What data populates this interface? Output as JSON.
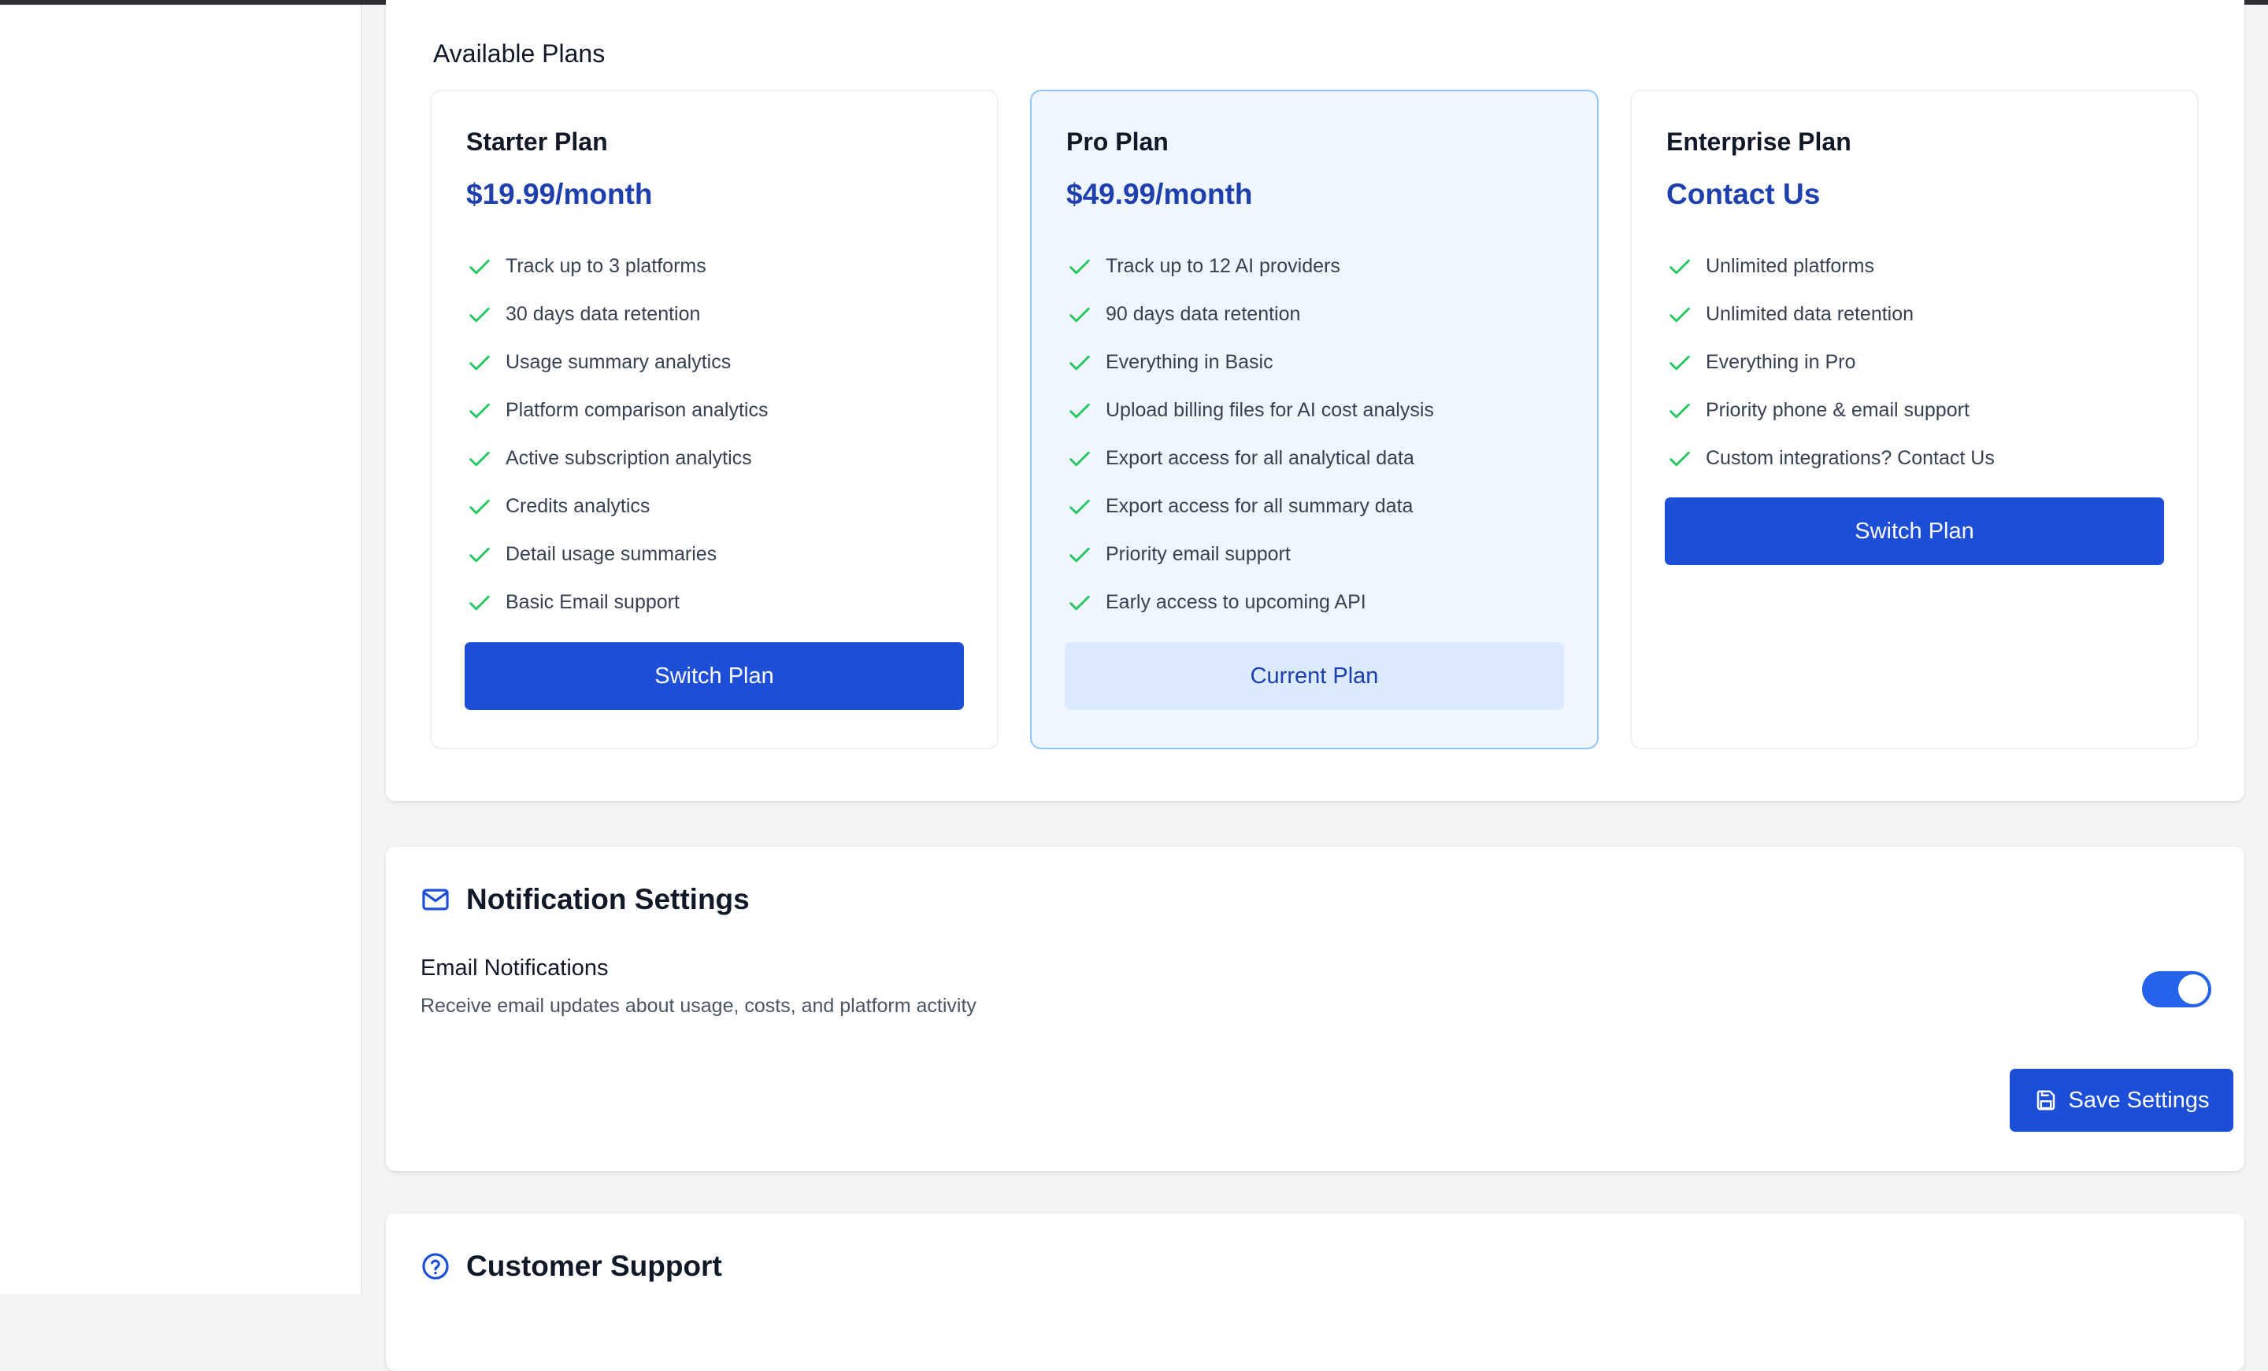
{
  "plans_section": {
    "title": "Available Plans",
    "plans": [
      {
        "name": "Starter Plan",
        "price": "$19.99/month",
        "features": [
          "Track up to 3 platforms",
          "30 days data retention",
          "Usage summary analytics",
          "Platform comparison analytics",
          "Active subscription analytics",
          "Credits analytics",
          "Detail usage summaries",
          "Basic Email support"
        ],
        "button_label": "Switch Plan"
      },
      {
        "name": "Pro Plan",
        "price": "$49.99/month",
        "features": [
          "Track up to 12 AI providers",
          "90 days data retention",
          "Everything in Basic",
          "Upload billing files for AI cost analysis",
          "Export access for all analytical data",
          "Export access for all summary data",
          "Priority email support",
          "Early access to upcoming API"
        ],
        "button_label": "Current Plan"
      },
      {
        "name": "Enterprise Plan",
        "price": "Contact Us",
        "features": [
          "Unlimited platforms",
          "Unlimited data retention",
          "Everything in Pro",
          "Priority phone & email support",
          "Custom integrations? Contact Us"
        ],
        "button_label": "Switch Plan"
      }
    ]
  },
  "notification_settings": {
    "icon": "mail-icon",
    "title": "Notification Settings",
    "email_label": "Email Notifications",
    "email_description": "Receive email updates about usage, costs, and platform activity",
    "email_enabled": true,
    "save_label": "Save Settings",
    "save_icon": "floppy-disk-icon"
  },
  "customer_support": {
    "icon": "help-circle-icon",
    "title": "Customer Support"
  },
  "colors": {
    "primary": "#1d4ed8",
    "price": "#1e40af",
    "check": "#22c55e",
    "current_plan_bg": "#eff6ff",
    "current_plan_border": "#93c5fd"
  }
}
